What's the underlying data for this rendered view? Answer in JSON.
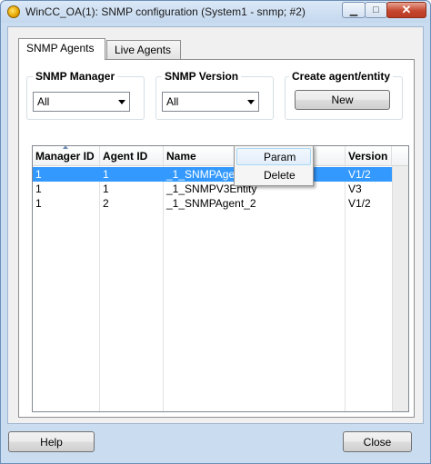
{
  "window": {
    "title": "WinCC_OA(1): SNMP configuration (System1 - snmp; #2)",
    "controls": {
      "minimize": "▁",
      "maximize": "□",
      "close": "✕"
    }
  },
  "tabs": [
    {
      "label": "SNMP Agents",
      "active": true
    },
    {
      "label": "Live Agents",
      "active": false
    }
  ],
  "filters": {
    "snmp_manager": {
      "title": "SNMP Manager",
      "selected": "All"
    },
    "snmp_version": {
      "title": "SNMP Version",
      "selected": "All"
    },
    "create": {
      "title": "Create agent/entity",
      "button_label": "New"
    }
  },
  "table": {
    "columns": [
      "Manager ID",
      "Agent ID",
      "Name",
      "Version"
    ],
    "sorted_column": "Manager ID",
    "rows": [
      {
        "manager_id": "1",
        "agent_id": "1",
        "name": "_1_SNMPAgent_1",
        "version": "V1/2",
        "selected": true
      },
      {
        "manager_id": "1",
        "agent_id": "1",
        "name": "_1_SNMPV3Entity",
        "version": "V3",
        "selected": false
      },
      {
        "manager_id": "1",
        "agent_id": "2",
        "name": "_1_SNMPAgent_2",
        "version": "V1/2",
        "selected": false
      }
    ]
  },
  "context_menu": {
    "items": [
      {
        "label": "Param",
        "highlighted": true
      },
      {
        "label": "Delete",
        "highlighted": false
      }
    ]
  },
  "footer": {
    "help_label": "Help",
    "close_label": "Close"
  },
  "colors": {
    "selection": "#3399ff",
    "title_bar": "#c4d8ee",
    "close_button": "#c6472f"
  },
  "icons": [
    "app-icon",
    "minimize-icon",
    "maximize-icon",
    "close-icon",
    "dropdown-arrow-icon",
    "sort-ascending-icon"
  ]
}
